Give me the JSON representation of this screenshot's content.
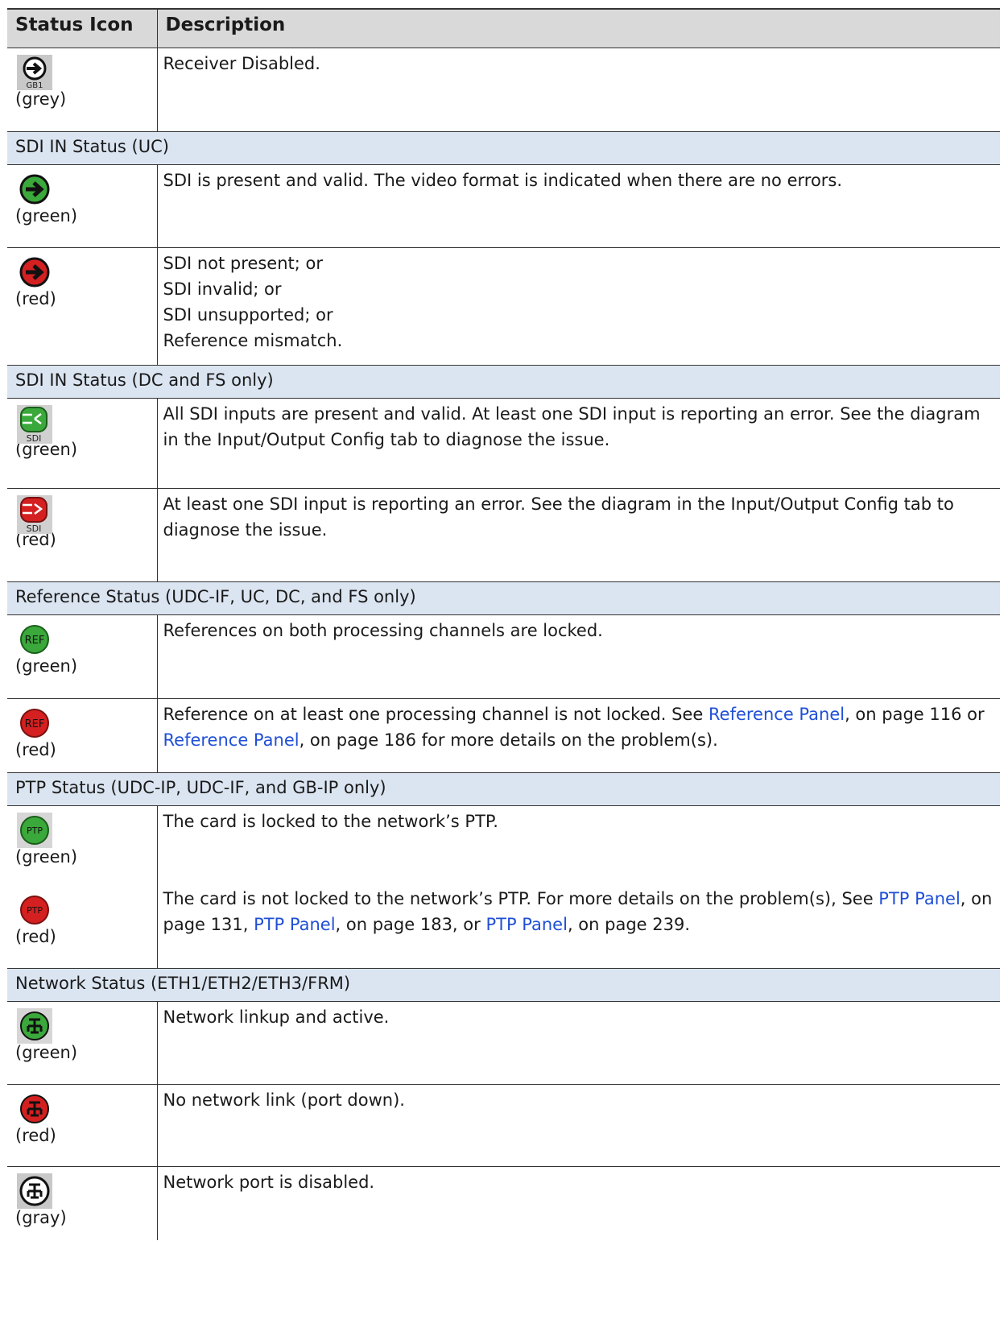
{
  "header": {
    "col_icon": "Status Icon",
    "col_desc": "Description"
  },
  "rows": {
    "receiver": {
      "icon": "arrow-gb1-grey-icon",
      "icon_text": "GB1",
      "color_note": "(grey)",
      "desc": "Receiver Disabled."
    },
    "sdi_uc_title": "SDI IN Status (UC)",
    "sdi_uc_green": {
      "icon": "arrow-green-icon",
      "color_note": "(green)",
      "desc": "SDI is present and valid. The video format is indicated when there are no errors."
    },
    "sdi_uc_red": {
      "icon": "arrow-red-icon",
      "color_note": "(red)",
      "lines": [
        "SDI not present; or",
        "SDI invalid; or",
        "SDI unsupported; or",
        "Reference mismatch."
      ]
    },
    "sdi_dc_title": "SDI IN Status (DC and FS only)",
    "sdi_dc_green": {
      "icon": "sdi-multi-green-icon",
      "icon_text": "SDI",
      "color_note": "(green)",
      "desc": "All SDI inputs are present and valid. At least one SDI input is reporting an error. See the diagram in the Input/Output Config tab to diagnose the issue."
    },
    "sdi_dc_red": {
      "icon": "sdi-multi-red-icon",
      "icon_text": "SDI",
      "color_note": "(red)",
      "desc": "At least one SDI input is reporting an error. See the diagram in the Input/Output Config tab to diagnose the issue."
    },
    "ref_title": "Reference Status (UDC-IF, UC, DC, and FS only)",
    "ref_green": {
      "icon": "ref-green-icon",
      "icon_text": "REF",
      "color_note": "(green)",
      "desc": "References on both processing channels are locked."
    },
    "ref_red": {
      "icon": "ref-red-icon",
      "icon_text": "REF",
      "color_note": "(red)",
      "desc_a": "Reference on at least one processing channel is not locked. See ",
      "link_a": "Reference Panel",
      "desc_b": ", on page 116 or ",
      "link_b": "Reference Panel",
      "desc_c": ", on page 186 for more details on the problem(s)."
    },
    "ptp_title": "PTP Status (UDC-IP, UDC-IF, and GB-IP only)",
    "ptp_green": {
      "icon": "ptp-green-icon",
      "icon_text": "PTP",
      "color_note": "(green)",
      "desc": "The card is locked to the network’s PTP."
    },
    "ptp_red": {
      "icon": "ptp-red-icon",
      "icon_text": "PTP",
      "color_note": "(red)",
      "desc_a": "The card is not locked to the network’s PTP. For more details on the problem(s), See ",
      "link_a": "PTP Panel",
      "desc_b": ", on page 131, ",
      "link_b": "PTP Panel",
      "desc_c": ", on page 183, or ",
      "link_c": "PTP Panel",
      "desc_d": ", on page 239."
    },
    "net_title": "Network Status (ETH1/ETH2/ETH3/FRM)",
    "net_green": {
      "icon": "network-green-icon",
      "color_note": "(green)",
      "desc": "Network linkup and active."
    },
    "net_red": {
      "icon": "network-red-icon",
      "color_note": "(red)",
      "desc": "No network link (port down)."
    },
    "net_gray": {
      "icon": "network-gray-icon",
      "color_note": "(gray)",
      "desc": "Network port is disabled."
    }
  },
  "colors": {
    "green": "#3aa83a",
    "red": "#d42020",
    "grey": "#c8c8c8",
    "section_bg": "#dbe5f1",
    "header_bg": "#d9d9d9",
    "link": "#1f4fd6"
  }
}
